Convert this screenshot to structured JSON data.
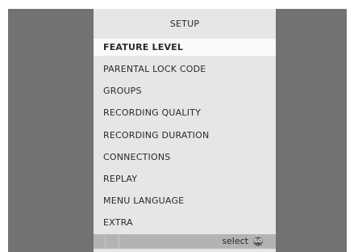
{
  "setup": {
    "title": "SETUP",
    "items": [
      {
        "label": "FEATURE  LEVEL",
        "selected": true
      },
      {
        "label": "PARENTAL  LOCK  CODE",
        "selected": false
      },
      {
        "label": "GROUPS",
        "selected": false
      },
      {
        "label": "RECORDING  QUALITY",
        "selected": false
      },
      {
        "label": "RECORDING  DURATION",
        "selected": false
      },
      {
        "label": "CONNECTIONS",
        "selected": false
      },
      {
        "label": "REPLAY",
        "selected": false
      },
      {
        "label": "MENU  LANGUAGE",
        "selected": false
      },
      {
        "label": "EXTRA",
        "selected": false
      }
    ],
    "footer": {
      "action_label": "select",
      "button_icon": "go-icon",
      "button_text": "GO"
    }
  },
  "colors": {
    "background": "#727272",
    "panel": "#e6e6e6",
    "highlight": "#fafafa",
    "footer_bar": "#b3b3b3"
  }
}
